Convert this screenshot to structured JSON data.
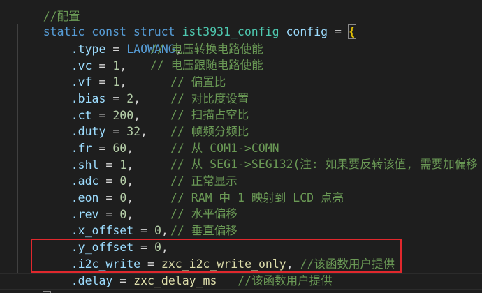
{
  "editor": {
    "theme_bg": "#1e1e1e",
    "lines": [
      {
        "comment": "//配置"
      },
      {
        "kw1": "static",
        "kw2": "const",
        "kw3": "struct",
        "type": "ist3931_config",
        "name": "config",
        "eq": "=",
        "brace": "{"
      },
      {
        "field": ".type",
        "eq": " = ",
        "value": "LAOWANG",
        "tail": ",",
        "comment": ""
      },
      {
        "field": ".vc",
        "eq": " = ",
        "value": "1",
        "tail": ",",
        "comment": "// 电压转换电路使能"
      },
      {
        "field": ".vf",
        "eq": " = ",
        "value": "1",
        "tail": ",",
        "comment": "// 电压跟随电路使能"
      },
      {
        "field": ".bias",
        "eq": " = ",
        "value": "2",
        "tail": ",",
        "comment": "// 偏置比"
      },
      {
        "field": ".ct",
        "eq": " = ",
        "value": "200",
        "tail": ",",
        "comment": "// 对比度设置"
      },
      {
        "field": ".duty",
        "eq": " = ",
        "value": "32",
        "tail": ",",
        "comment": "// 扫描占空比"
      },
      {
        "field": ".fr",
        "eq": " = ",
        "value": "60",
        "tail": ",",
        "comment": "// 帧频分频比"
      },
      {
        "field": ".shl",
        "eq": " = ",
        "value": "1",
        "tail": ",",
        "comment": "// 从 COM1->COMN"
      },
      {
        "field": ".adc",
        "eq": " = ",
        "value": "0",
        "tail": ",",
        "comment": "// 从 SEG1->SEG132(注: 如果要反转该值, 需要加偏移"
      },
      {
        "field": ".eon",
        "eq": " = ",
        "value": "0",
        "tail": ",",
        "comment": "// 正常显示"
      },
      {
        "field": ".rev",
        "eq": " = ",
        "value": "0",
        "tail": ",",
        "comment": "// RAM 中 1 映射到 LCD 点亮"
      },
      {
        "field": ".x_offset",
        "eq": " = ",
        "value": "0",
        "tail": ",",
        "comment": "// 水平偏移"
      },
      {
        "field": ".y_offset",
        "eq": " = ",
        "value": "0",
        "tail": ",",
        "comment": "// 垂直偏移"
      },
      {
        "field": ".i2c_write",
        "eq": " = ",
        "value": "zxc_i2c_write_only",
        "tail": ",",
        "comment": "//该函数用户提供"
      },
      {
        "field": ".delay",
        "eq": " = ",
        "value": "zxc_delay_ms",
        "tail": "",
        "comment": "//该函数用户提供"
      },
      {
        "close": "}",
        "semi": ";"
      }
    ]
  }
}
